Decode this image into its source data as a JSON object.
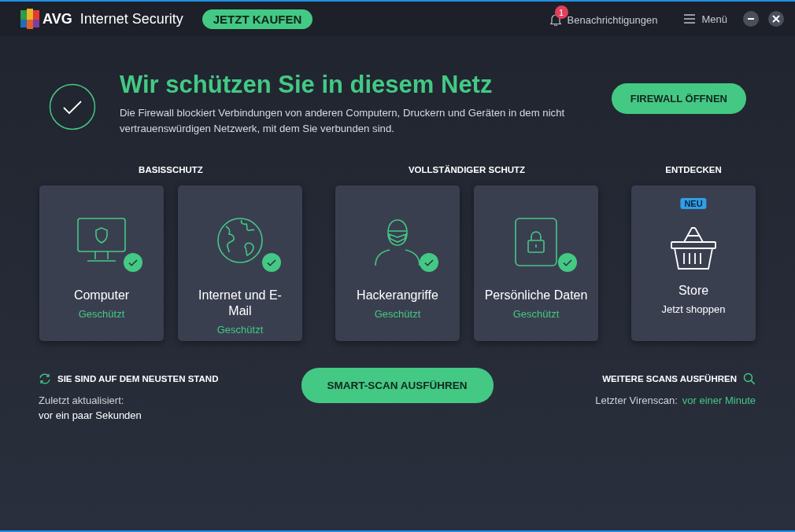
{
  "app": {
    "brand": "AVG",
    "product": "Internet Security",
    "buy_button": "JETZT KAUFEN",
    "notifications": {
      "count": "1",
      "label": "Benachrichtigungen"
    },
    "menu": "Menü"
  },
  "status": {
    "protected": true,
    "headline": "Wir schützen Sie in diesem Netz",
    "description": "Die Firewall blockiert Verbindungen von anderen Computern, Druckern und Geräten in dem nicht vertrauenswürdigen Netzwerk, mit dem Sie verbunden sind.",
    "button": "FIREWALL ÖFFNEN"
  },
  "groups": [
    {
      "title": "BASISSCHUTZ",
      "cards": [
        {
          "kind": "feature",
          "title": "Computer",
          "status": "Geschützt",
          "protected": true
        },
        {
          "kind": "feature",
          "title": "Internet und E-Mail",
          "status": "Geschützt",
          "protected": true
        }
      ]
    },
    {
      "title": "VOLLSTÄNDIGER SCHUTZ",
      "cards": [
        {
          "kind": "feature",
          "title": "Hackerangriffe",
          "status": "Geschützt",
          "protected": true
        },
        {
          "kind": "feature",
          "title": "Persönliche Daten",
          "status": "Geschützt",
          "protected": true
        }
      ]
    },
    {
      "title": "ENTDECKEN",
      "cards": [
        {
          "kind": "store",
          "badge": "NEU",
          "title": "Store",
          "subtitle": "Jetzt shoppen"
        }
      ]
    }
  ],
  "footer": {
    "update": {
      "title": "SIE SIND AUF DEM NEUSTEN STAND",
      "label": "Zuletzt aktualisiert:",
      "value": "vor ein paar Sekunden"
    },
    "scan_button": "SMART-SCAN AUSFÜHREN",
    "more_scans": {
      "title": "WEITERE SCANS AUSFÜHREN",
      "label": "Letzter Virenscan:",
      "value": "vor einer Minute"
    }
  }
}
